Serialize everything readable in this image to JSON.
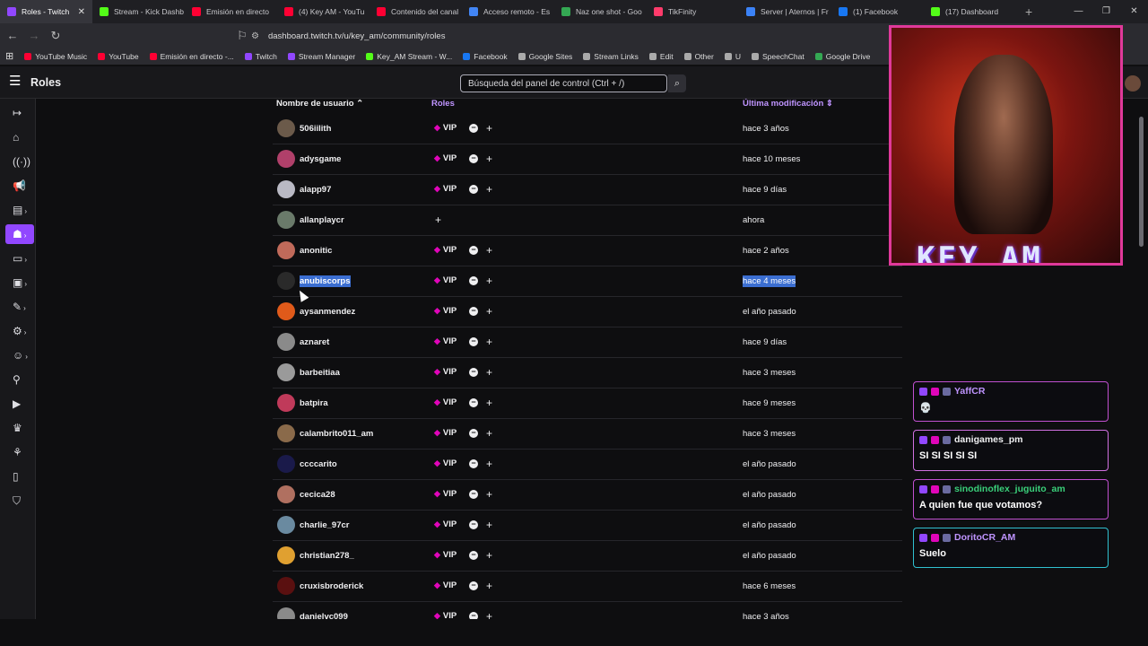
{
  "browser": {
    "tabs": [
      {
        "title": "Roles - Twitch",
        "color": "#9147ff",
        "active": true
      },
      {
        "title": "Stream - Kick Dashb",
        "color": "#53fc18"
      },
      {
        "title": "Emisión en directo",
        "color": "#ff0033"
      },
      {
        "title": "(4) Key AM - YouTu",
        "color": "#ff0033"
      },
      {
        "title": "Contenido del canal",
        "color": "#ff0033"
      },
      {
        "title": "Acceso remoto - Es",
        "color": "#4285f4"
      },
      {
        "title": "Naz one shot - Goo",
        "color": "#34a853"
      },
      {
        "title": "TikFinity",
        "color": "#ff3b6b"
      },
      {
        "title": "Server | Aternos | Fr",
        "color": "#3b82f6"
      },
      {
        "title": "(1) Facebook",
        "color": "#1877f2"
      },
      {
        "title": "(17) Dashboard",
        "color": "#53fc18"
      }
    ],
    "url": "dashboard.twitch.tv/u/key_am/community/roles",
    "bookmarks": [
      {
        "label": "YouTube Music",
        "color": "#ff0033"
      },
      {
        "label": "YouTube",
        "color": "#ff0033"
      },
      {
        "label": "Emisión en directo -...",
        "color": "#ff0033"
      },
      {
        "label": "Twitch",
        "color": "#9147ff"
      },
      {
        "label": "Stream Manager",
        "color": "#9147ff"
      },
      {
        "label": "Key_AM Stream - W...",
        "color": "#53fc18"
      },
      {
        "label": "Facebook",
        "color": "#1877f2"
      },
      {
        "label": "Google Sites",
        "color": "#aaaaaa"
      },
      {
        "label": "Stream Links",
        "color": "#aaaaaa"
      },
      {
        "label": "Edit",
        "color": "#aaaaaa"
      },
      {
        "label": "Other",
        "color": "#aaaaaa"
      },
      {
        "label": "U",
        "color": "#aaaaaa"
      },
      {
        "label": "SpeechChat",
        "color": "#aaaaaa"
      },
      {
        "label": "Google Drive",
        "color": "#34a853"
      }
    ]
  },
  "header": {
    "title": "Roles",
    "search_placeholder": "Búsqueda del panel de control (Ctrl + /)"
  },
  "table": {
    "columns": {
      "user": "Nombre de usuario",
      "roles": "Roles",
      "modified": "Última modificación"
    },
    "vip_label": "VIP",
    "rows": [
      {
        "user": "506iilith",
        "vip": true,
        "modified": "hace 3 años",
        "avatar": "#6b5a4a"
      },
      {
        "user": "adysgame",
        "vip": true,
        "modified": "hace 10 meses",
        "avatar": "#b0406a"
      },
      {
        "user": "alapp97",
        "vip": true,
        "modified": "hace 9 días",
        "avatar": "#b9b9c4"
      },
      {
        "user": "allanplaycr",
        "vip": false,
        "modified": "ahora",
        "avatar": "#6a7a6a"
      },
      {
        "user": "anonitic",
        "vip": true,
        "modified": "hace 2 años",
        "avatar": "#c06a5a"
      },
      {
        "user": "anubiscorps",
        "vip": true,
        "modified": "hace 4 meses",
        "avatar": "#2a2a2a",
        "selected": true
      },
      {
        "user": "aysanmendez",
        "vip": true,
        "modified": "el año pasado",
        "avatar": "#e05a1a"
      },
      {
        "user": "aznaret",
        "vip": true,
        "modified": "hace 9 días",
        "avatar": "#8a8a8a"
      },
      {
        "user": "barbeitiaa",
        "vip": true,
        "modified": "hace 3 meses",
        "avatar": "#9a9a9a"
      },
      {
        "user": "batpira",
        "vip": true,
        "modified": "hace 9 meses",
        "avatar": "#c03a5a"
      },
      {
        "user": "calambrito011_am",
        "vip": true,
        "modified": "hace 3 meses",
        "avatar": "#8a6a4a"
      },
      {
        "user": "ccccarito",
        "vip": true,
        "modified": "el año pasado",
        "avatar": "#1a1a4a"
      },
      {
        "user": "cecica28",
        "vip": true,
        "modified": "el año pasado",
        "avatar": "#b07060"
      },
      {
        "user": "charlie_97cr",
        "vip": true,
        "modified": "el año pasado",
        "avatar": "#6a8aa0"
      },
      {
        "user": "christian278_",
        "vip": true,
        "modified": "el año pasado",
        "avatar": "#e0a030"
      },
      {
        "user": "cruxisbroderick",
        "vip": true,
        "modified": "hace 6 meses",
        "avatar": "#5a1010"
      },
      {
        "user": "danielvc099",
        "vip": true,
        "modified": "hace 3 años",
        "avatar": "#8a8a8a"
      }
    ]
  },
  "stream": {
    "overlay_logo": "KEY_AM",
    "chat": [
      {
        "user": "YaffCR",
        "message": "💀",
        "color": "#bf94ff",
        "border": "#c050d0"
      },
      {
        "user": "danigames_pm",
        "message": "SI SI SI SI SI",
        "color": "#efeff1",
        "border": "#d070e0"
      },
      {
        "user": "sinodinoflex_juguito_am",
        "message": "A quien fue que votamos?",
        "color": "#3ad07a",
        "border": "#c050d0"
      },
      {
        "user": "DoritoCR_AM",
        "message": "Suelo",
        "color": "#bf94ff",
        "border": "#30c0d0"
      }
    ]
  }
}
